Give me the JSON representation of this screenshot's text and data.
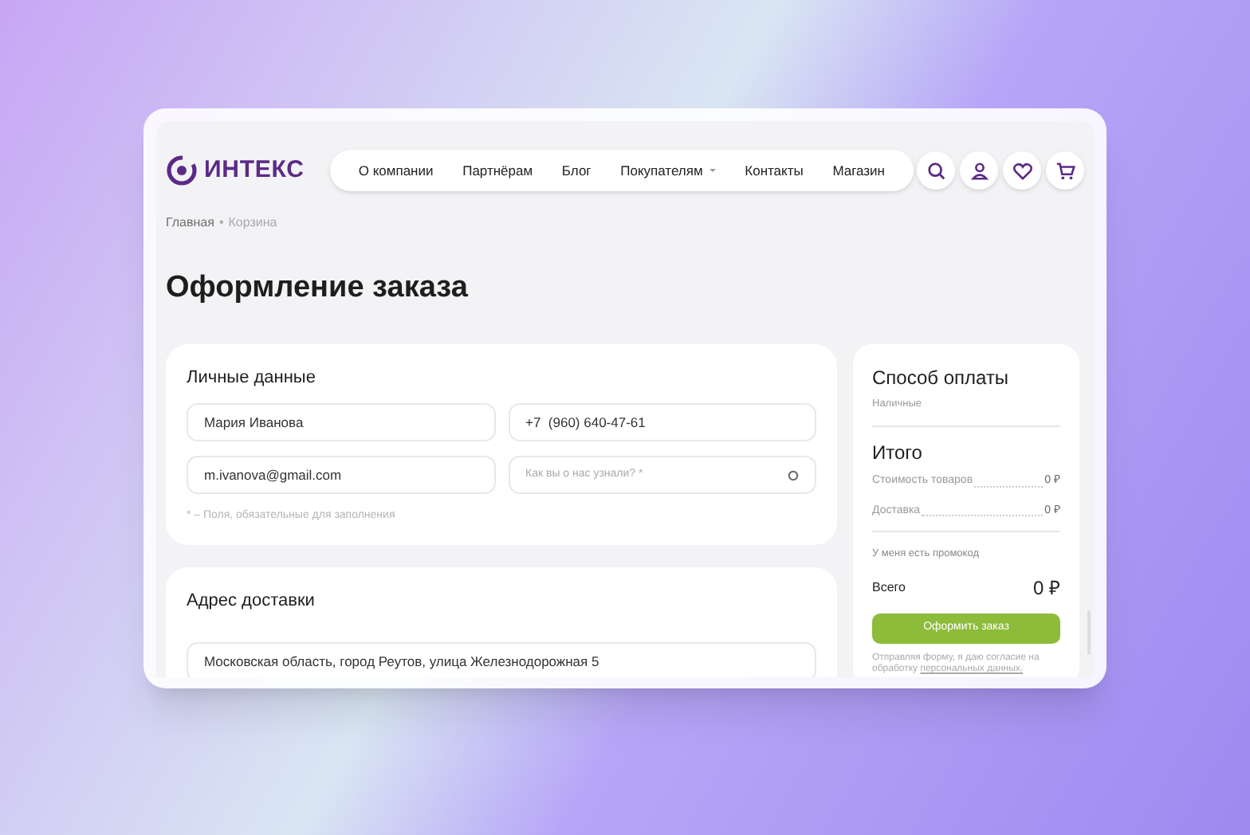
{
  "logo": {
    "text": "ИНТЕКС"
  },
  "nav": [
    {
      "label": "О компании",
      "dropdown": false
    },
    {
      "label": "Партнёрам",
      "dropdown": false
    },
    {
      "label": "Блог",
      "dropdown": false
    },
    {
      "label": "Покупателям",
      "dropdown": true
    },
    {
      "label": "Контакты",
      "dropdown": false
    },
    {
      "label": "Магазин",
      "dropdown": false
    }
  ],
  "breadcrumbs": [
    {
      "label": "Главная",
      "current": false
    },
    {
      "label": "Корзина",
      "current": true
    }
  ],
  "separator": "•",
  "title": "Оформление заказа",
  "personal": {
    "title": "Личные данные",
    "fields": [
      {
        "kind": "text",
        "value": "Мария Иванова"
      },
      {
        "kind": "text",
        "value": "+7  (960) 640-47-61"
      },
      {
        "kind": "text",
        "value": "m.ivanova@gmail.com"
      },
      {
        "kind": "select",
        "placeholder": "Как вы о нас узнали? *"
      }
    ],
    "note": "* – Поля, обязательные для заполнения"
  },
  "address": {
    "title": "Адрес доставки",
    "value": "Московская область, город Реутов, улица Железнодорожная 5"
  },
  "payment": {
    "title": "Способ оплаты",
    "method": "Наличные"
  },
  "total": {
    "title": "Итого",
    "lines": [
      {
        "label": "Стоимость товаров",
        "value": "0 ₽"
      },
      {
        "label": "Доставка",
        "value": "0 ₽"
      }
    ],
    "promo": "У меня есть промокод",
    "sum_label": "Всего",
    "sum_value": "0 ₽",
    "button": "Оформить заказ",
    "consent": "Отправляя форму, я даю согласие на обработку",
    "consent_link": "персональных данных."
  }
}
